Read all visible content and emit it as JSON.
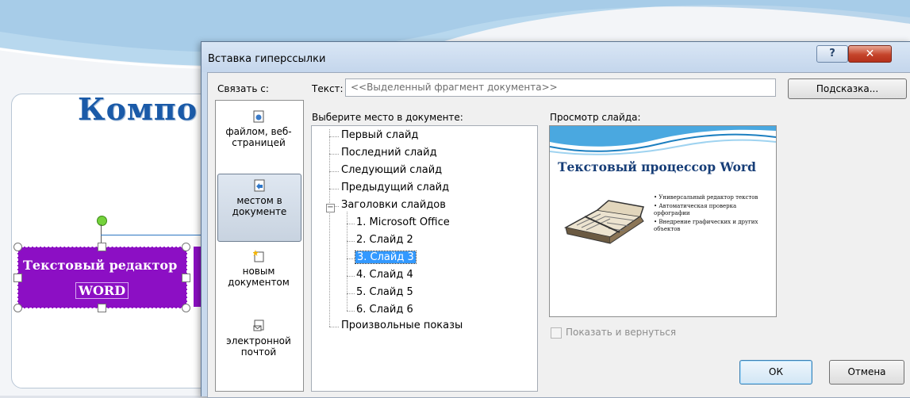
{
  "slide": {
    "title_fragment": "Компо",
    "shape_text_line1": "Текстовый редактор",
    "shape_text_line2": "WORD"
  },
  "dialog": {
    "title": "Вставка гиперссылки",
    "help_glyph": "?",
    "close_glyph": "✕",
    "link_with_label": "Связать с:",
    "text_label": "Текст:",
    "text_value": "<<Выделенный фрагмент документа>>",
    "hint_button": "Подсказка...",
    "nav": [
      {
        "line1": "файлом, веб-",
        "line2": "страницей",
        "icon": "file-web-icon"
      },
      {
        "line1": "местом в",
        "line2": "документе",
        "icon": "place-in-document-icon"
      },
      {
        "line1": "новым",
        "line2": "документом",
        "icon": "new-document-icon"
      },
      {
        "line1": "электронной",
        "line2": "почтой",
        "icon": "email-icon"
      }
    ],
    "place_label": "Выберите место в документе:",
    "tree": {
      "first": "Первый слайд",
      "last": "Последний слайд",
      "next": "Следующий слайд",
      "prev": "Предыдущий слайд",
      "headings": "Заголовки слайдов",
      "slides": [
        "1. Microsoft Office",
        "2. Слайд 2",
        "3. Слайд 3",
        "4. Слайд 4",
        "5. Слайд 5",
        "6. Слайд 6"
      ],
      "custom": "Произвольные показы",
      "selected_index": 2
    },
    "preview_label": "Просмотр слайда:",
    "preview": {
      "title": "Текстовый процессор Word",
      "bullets": [
        "Универсальный редактор текстов",
        "Автоматическая проверка орфографии",
        "Внедрение графических и других объектов"
      ]
    },
    "show_and_return": "Показать и вернуться",
    "ok": "ОК",
    "cancel": "Отмена"
  }
}
